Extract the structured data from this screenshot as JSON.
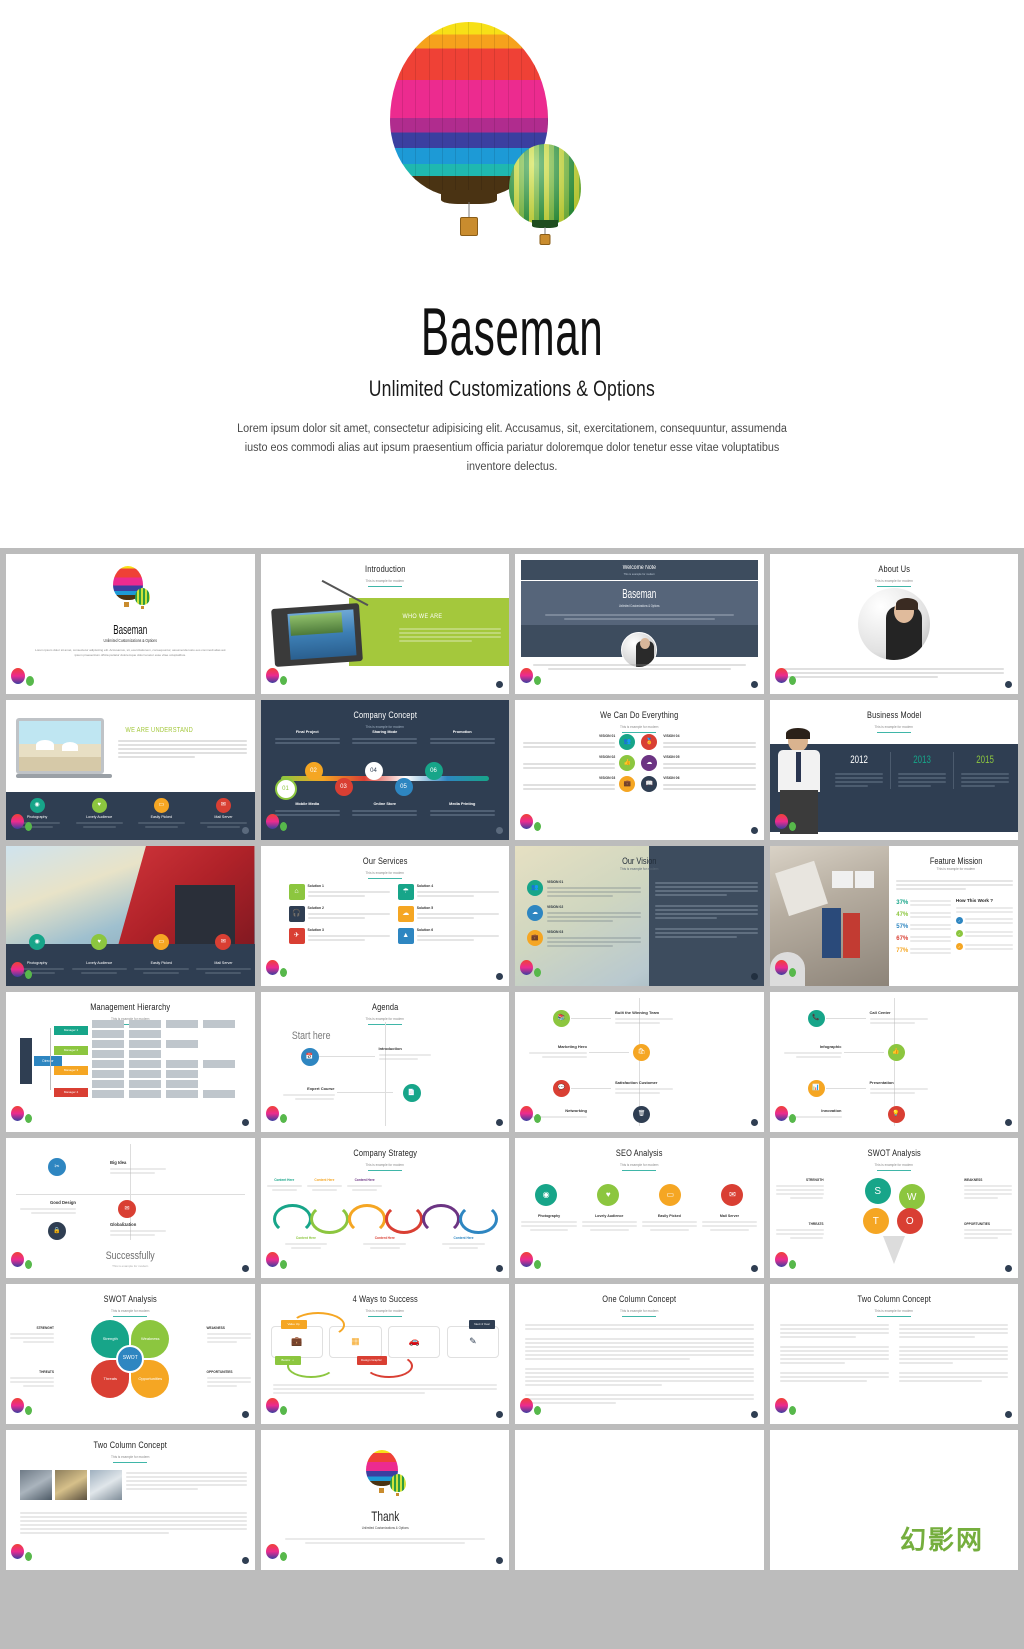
{
  "hero": {
    "title": "Baseman",
    "subtitle": "Unlimited Customizations & Options",
    "body": "Lorem ipsum dolor sit amet, consectetur adipisicing elit. Accusamus, sit, exercitationem, consequuntur, assumenda iusto eos commodi alias aut ipsum praesentium officia pariatur doloremque dolor tenetur esse vitae voluptatibus inventore delectus.",
    "balloon_main_icon": "hot-air-balloon-rainbow",
    "balloon_small_icon": "hot-air-balloon-green"
  },
  "watermark": "幻影网",
  "common": {
    "subtitle": "This is example for modern",
    "lorem_short": "Lorem ipsum dolor sit amet, consectetur adipisicing elit."
  },
  "slides": [
    {
      "n": 1,
      "name": "title-slide",
      "title": "Baseman",
      "subtitle": "Unlimited Customizations & Options",
      "body": "Lorem ipsum dolor sit amet, consectetur adipisicing elit. Accusamus, sit, exercitationem, consequuntur, assumenda iusto eos commodi alias aut ipsum praesentium officia pariatur doloremque dolor tenetur esse vitae voluptatibus.",
      "theme": "light"
    },
    {
      "n": 2,
      "name": "introduction",
      "title": "Introduction",
      "subtitle": "This is example for modern",
      "panel_heading": "WHO WE ARE",
      "accent": "#a4c83c",
      "theme": "light"
    },
    {
      "n": 3,
      "name": "welcome-note",
      "title": "Welcome Note",
      "subtitle": "This is example for modern",
      "big_title": "Baseman",
      "big_subtitle": "Unlimited Customizations & Options",
      "accent": "#3d4c5e",
      "theme": "dark"
    },
    {
      "n": 4,
      "name": "about-us",
      "title": "About Us",
      "subtitle": "This is example for modern",
      "theme": "light"
    },
    {
      "n": 5,
      "name": "we-are-understand",
      "title": "WE ARE UNDERSTAND",
      "features": [
        "Photography",
        "Lovely Audience",
        "Easily Picked",
        "Mail Server"
      ],
      "accent": "#2f3e52",
      "theme": "dark"
    },
    {
      "n": 6,
      "name": "company-concept",
      "title": "Company Concept",
      "subtitle": "This is example for modern",
      "steps": [
        "01",
        "02",
        "03",
        "04",
        "05",
        "06"
      ],
      "labels_top": [
        "Final Project",
        "Sharing Mode",
        "Promotion"
      ],
      "labels_bottom": [
        "Mobile Media",
        "Online Store",
        "Media Printing"
      ],
      "accent": "#2f3e52",
      "theme": "dark"
    },
    {
      "n": 7,
      "name": "we-can-do-everything",
      "title": "We Can Do Everything",
      "subtitle": "This is example for modern",
      "items": [
        "VISION 01",
        "VISION 04",
        "VISION 02",
        "VISION 05",
        "VISION 03",
        "VISION 06"
      ],
      "theme": "light"
    },
    {
      "n": 8,
      "name": "business-model",
      "title": "Business Model",
      "subtitle": "This is example for modern",
      "years": [
        "2012",
        "2013",
        "2015"
      ],
      "theme": "light"
    },
    {
      "n": 9,
      "name": "photo-features",
      "title": "",
      "features": [
        "Photography",
        "Lovely Audience",
        "Easily Picked",
        "Mail Server"
      ],
      "theme": "photo"
    },
    {
      "n": 10,
      "name": "our-services",
      "title": "Our Services",
      "subtitle": "This is example for modern",
      "services": [
        "Solution 1",
        "Solution 4",
        "Solution 2",
        "Solution 5",
        "Solution 3",
        "Solution 6"
      ],
      "theme": "light"
    },
    {
      "n": 11,
      "name": "our-vision",
      "title": "Our Vision",
      "subtitle": "This is example for modern",
      "items": [
        "VISION 01",
        "VISION 02",
        "VISION 03"
      ],
      "theme": "light"
    },
    {
      "n": 12,
      "name": "feature-mission",
      "title": "Feature Mission",
      "subtitle": "This is example for modern",
      "percents": [
        "37%",
        "47%",
        "57%",
        "67%",
        "77%"
      ],
      "side_heading": "How This Work ?",
      "theme": "light"
    },
    {
      "n": 13,
      "name": "management-hierarchy",
      "title": "Management Hierarchy",
      "subtitle": "This is example for modern",
      "managers": [
        "Manager 1",
        "Manager 2",
        "Manager 3",
        "Manager 4"
      ],
      "root": "Director",
      "cols": [
        "Sub Mgr",
        "Supervisor",
        "Supervisor",
        "Staff"
      ],
      "theme": "light"
    },
    {
      "n": 14,
      "name": "agenda",
      "title": "Agenda",
      "subtitle": "This is example for modern",
      "start": "Start here",
      "items": [
        "Introduction",
        "Expert Course"
      ],
      "theme": "light"
    },
    {
      "n": 15,
      "name": "build-winning-team",
      "title": "",
      "items": [
        "Built the Winning Team",
        "Marketing Hero",
        "Satisfaction Customer",
        "Networking"
      ],
      "theme": "light"
    },
    {
      "n": 16,
      "name": "call-center",
      "title": "",
      "items": [
        "Call Center",
        "Infographic",
        "Presentation",
        "Innovation"
      ],
      "theme": "light"
    },
    {
      "n": 17,
      "name": "successfully",
      "title": "Successfully",
      "subtitle": "This is example for modern",
      "items": [
        "Big Idea",
        "Good Design",
        "Globalization"
      ],
      "theme": "light"
    },
    {
      "n": 18,
      "name": "company-strategy",
      "title": "Company Strategy",
      "subtitle": "This is example for modern",
      "columns": [
        "Content Here",
        "Content Here",
        "Content Here",
        "Content Here",
        "Content Here",
        "Content Here"
      ],
      "theme": "light"
    },
    {
      "n": 19,
      "name": "seo-analysis",
      "title": "SEO Analysis",
      "subtitle": "This is example for modern",
      "items": [
        "Photography",
        "Lovely Audience",
        "Easily Picked",
        "Mail Server"
      ],
      "theme": "light"
    },
    {
      "n": 20,
      "name": "swot-analysis-circles",
      "title": "SWOT Analysis",
      "subtitle": "This is example for modern",
      "letters": [
        "S",
        "W",
        "O",
        "T"
      ],
      "labels": [
        "STRENGTH",
        "WEAKNESS",
        "THREATS",
        "OPPORTUNITIES"
      ],
      "theme": "light"
    },
    {
      "n": 21,
      "name": "swot-analysis-petals",
      "title": "SWOT Analysis",
      "subtitle": "This is example for modern",
      "center": "SWOT",
      "petals": [
        "Strength",
        "Weakness",
        "Threats",
        "Opportunities"
      ],
      "labels": [
        "STRENGHT",
        "WEAKNESS",
        "THREATS",
        "OPPORTUNITIES"
      ],
      "theme": "light"
    },
    {
      "n": 22,
      "name": "four-ways-to-success",
      "title": "4 Ways to Success",
      "subtitle": "This is example for modern",
      "cards": [
        "Value Up",
        "Business",
        "Design Graphic",
        "Next 4 Year"
      ],
      "theme": "light"
    },
    {
      "n": 23,
      "name": "one-column-concept",
      "title": "One Column Concept",
      "subtitle": "This is example for modern",
      "theme": "light"
    },
    {
      "n": 24,
      "name": "two-column-concept",
      "title": "Two Column Concept",
      "subtitle": "This is example for modern",
      "theme": "light"
    },
    {
      "n": 25,
      "name": "two-column-concept-images",
      "title": "Two Column Concept",
      "subtitle": "This is example for modern",
      "theme": "light"
    },
    {
      "n": 26,
      "name": "thank-you",
      "title": "Thank",
      "subtitle": "Unlimited Customizations & Options",
      "body": "Lorem ipsum dolor sit amet, consectetur adipisicing elit. Accusamus, sit, exercitationem, consequuntur, assumenda iusto eos commodi alias aut.",
      "theme": "light"
    },
    {
      "n": 27,
      "name": "blank-slide-a",
      "title": "",
      "theme": "light"
    },
    {
      "n": 28,
      "name": "blank-slide-b",
      "title": "",
      "theme": "light"
    }
  ],
  "palette": {
    "teal": "#17a589",
    "green": "#8cc63f",
    "orange": "#f5a623",
    "red": "#d93f33",
    "blue": "#2e86c1",
    "purple": "#6c3483",
    "dark": "#2f3e52",
    "slate": "#3d4c5e",
    "olive": "#a4c83c"
  }
}
